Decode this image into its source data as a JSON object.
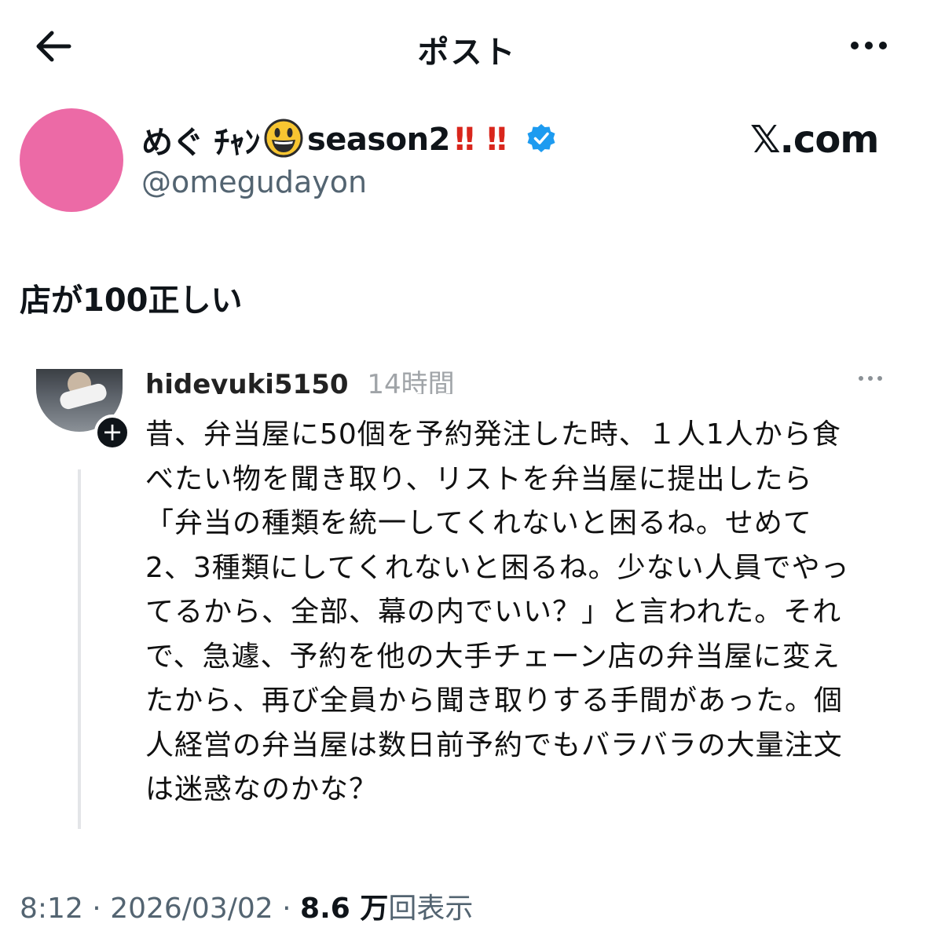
{
  "header": {
    "title": "ポスト"
  },
  "author": {
    "name_part1": "めぐ ﾁｬﾝ",
    "emoji": "grinning-face-emoji",
    "name_part2": "season2",
    "exclaim_1": "‼",
    "exclaim_2": "‼",
    "handle": "@omegudayon",
    "verified": true
  },
  "watermark": "𝕏.com",
  "post": {
    "text": "店が100正しい"
  },
  "embedded_reply": {
    "username": "hideyuki5150",
    "time": "14時間",
    "lines": [
      "昔、弁当屋に50個を予約発注した時、１人1人から食",
      "べたい物を聞き取り、リストを弁当屋に提出したら",
      "「弁当の種類を統一してくれないと困るね。せめて",
      "2、3種類にしてくれないと困るね。少ない人員でやっ",
      "てるから、全部、幕の内でいい？」と言われた。それ",
      "で、急遽、予約を他の大手チェーン店の弁当屋に変え",
      "たから、再び全員から聞き取りする手間があった。個",
      "人経営の弁当屋は数日前予約でもバラバラの大量注文",
      "は迷惑なのかな？"
    ]
  },
  "meta": {
    "time": "8:12",
    "separator_1": " · ",
    "date": "2026/03/02",
    "separator_2": " · ",
    "views_count": "8.6 万",
    "views_label": "回表示"
  },
  "colors": {
    "avatar": "#ec6aa6",
    "verified": "#1d9bf0",
    "exclaim": "#d9261c",
    "secondary_text": "#536471"
  }
}
